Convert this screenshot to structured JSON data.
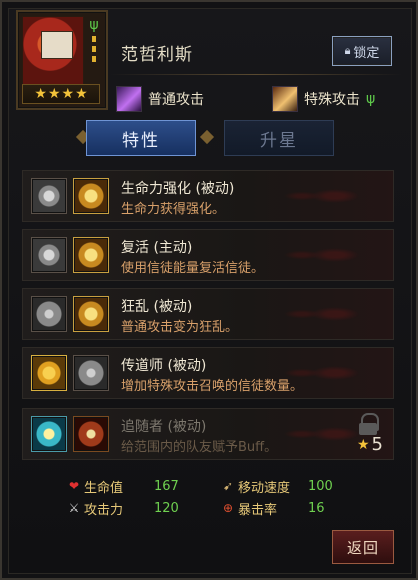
{
  "hero": {
    "name": "范哲利斯",
    "stars": [
      "★",
      "★",
      "★",
      "★"
    ],
    "lock_label": "锁定"
  },
  "attacks": {
    "normal_label": "普通攻击",
    "special_label": "特殊攻击"
  },
  "tabs": [
    {
      "label": "特性"
    },
    {
      "label": "升星"
    }
  ],
  "skills": [
    {
      "title": "生命力强化 (被动)",
      "desc": "生命力获得强化。"
    },
    {
      "title": "复活 (主动)",
      "desc": "使用信徒能量复活信徒。"
    },
    {
      "title": "狂乱 (被动)",
      "desc": "普通攻击变为狂乱。"
    },
    {
      "title": "传道师 (被动)",
      "desc": "增加特殊攻击召唤的信徒数量。"
    },
    {
      "title": "追随者 (被动)",
      "desc": "给范围内的队友赋予Buff。",
      "rank": "5"
    }
  ],
  "stats": {
    "hp_label": "生命值",
    "hp_value": "167",
    "atk_label": "攻击力",
    "atk_value": "120",
    "speed_label": "移动速度",
    "speed_value": "100",
    "crit_label": "暴击率",
    "crit_value": "16"
  },
  "buttons": {
    "return_label": "返回"
  },
  "colors": {
    "gold": "#f3c33a",
    "tab_active": "#2d4e8a",
    "desc_text": "#d8a06a",
    "stat_value": "#6fd050"
  }
}
